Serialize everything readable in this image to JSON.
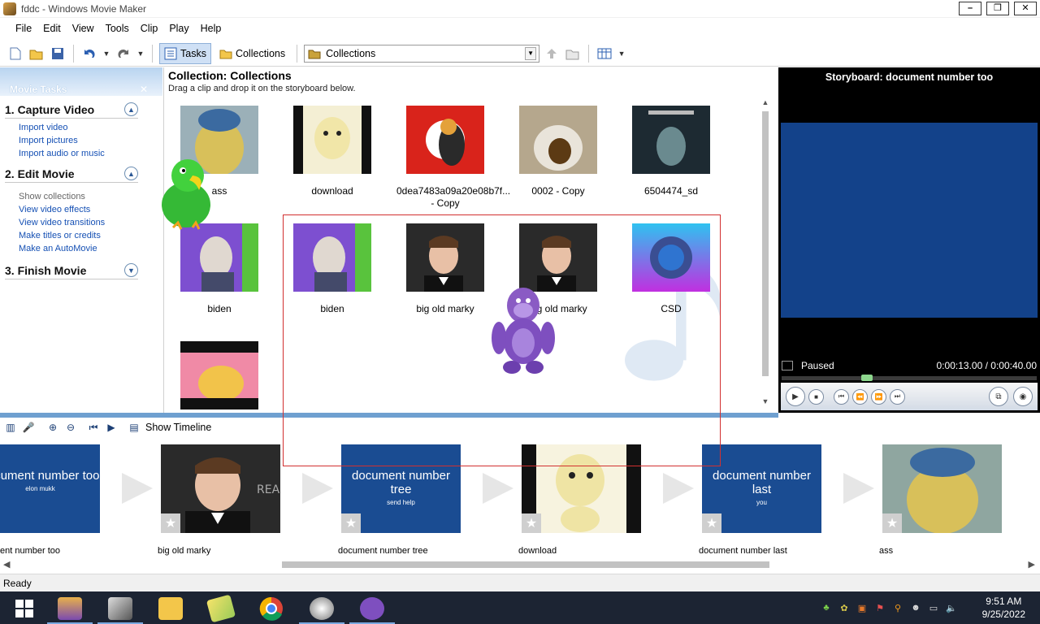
{
  "window": {
    "title": "fddc - Windows Movie Maker",
    "controls": [
      "–",
      "❐",
      "✕"
    ]
  },
  "menu": [
    "File",
    "Edit",
    "View",
    "Tools",
    "Clip",
    "Play",
    "Help"
  ],
  "toolbar": {
    "tasks_label": "Tasks",
    "collections_label": "Collections",
    "collections_select": "Collections"
  },
  "task_pane": {
    "header": "Movie Tasks",
    "sections": [
      {
        "title": "1. Capture Video",
        "links": [
          "Import video",
          "Import pictures",
          "Import audio or music"
        ]
      },
      {
        "title": "2. Edit Movie",
        "links": [
          "Show collections",
          "View video effects",
          "View video transitions",
          "Make titles or credits",
          "Make an AutoMovie"
        ]
      },
      {
        "title": "3. Finish Movie",
        "links": []
      }
    ]
  },
  "collection": {
    "title": "Collection: Collections",
    "subtitle": "Drag a clip and drop it on the storyboard below.",
    "clips": [
      {
        "label": "ass",
        "color": "#b89a55"
      },
      {
        "label": "download",
        "color": "#efe6b0"
      },
      {
        "label": "0dea7483a09a20e08b7f...\n- Copy",
        "color": "#d9231b"
      },
      {
        "label": "0002 - Copy",
        "color": "#a58f6e"
      },
      {
        "label": "6504474_sd",
        "color": "#1d2a32"
      },
      {
        "label": "biden",
        "color": "#6d4fb4"
      },
      {
        "label": "biden",
        "color": "#6d4fb4"
      },
      {
        "label": "big old marky",
        "color": "#2a2a2a"
      },
      {
        "label": "big old marky",
        "color": "#2a2a2a"
      },
      {
        "label": "CSD",
        "color": "#5b7df0"
      },
      {
        "label": "",
        "color": "#e65c7a"
      }
    ]
  },
  "preview": {
    "title": "Storyboard: document number too",
    "status": "Paused",
    "time": "0:00:13.00 / 0:00:40.00",
    "progress": 0.325
  },
  "storyboard_toolbar": {
    "show_timeline": "Show Timeline"
  },
  "storyboard": [
    {
      "caption": "ent number too",
      "card_title": "document number too",
      "card_sub": "elon mukk",
      "kind": "title"
    },
    {
      "caption": "big old marky",
      "kind": "clip",
      "color": "#2a2a2a"
    },
    {
      "caption": "document number tree",
      "card_title": "document number tree",
      "card_sub": "send help",
      "kind": "title"
    },
    {
      "caption": "download",
      "kind": "clip",
      "color": "#efe6b0"
    },
    {
      "caption": "document number last",
      "card_title": "document number last",
      "card_sub": "you",
      "kind": "title"
    },
    {
      "caption": "ass",
      "kind": "clip",
      "color": "#b89a55"
    }
  ],
  "status_bar": "Ready",
  "clock": {
    "time": "9:51 AM",
    "date": "9/25/2022"
  }
}
